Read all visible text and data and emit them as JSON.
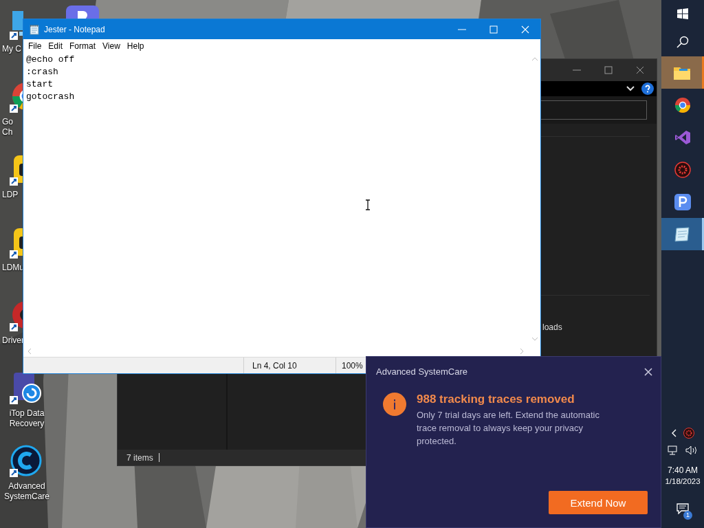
{
  "desktop": {
    "icons": [
      {
        "kind": "computer",
        "label": "My C"
      },
      {
        "kind": "chrome",
        "label": "Go\nCh"
      },
      {
        "kind": "ldplayer",
        "label": "LDP"
      },
      {
        "kind": "ldmulti",
        "label": "LDMu"
      },
      {
        "kind": "driver",
        "label": "Driver"
      },
      {
        "kind": "itop",
        "label": "iTop Data\nRecovery"
      },
      {
        "kind": "asc",
        "label": "Advanced\nSystemCare"
      }
    ]
  },
  "explorer": {
    "nav_item": "loads",
    "status_bar": "7 items"
  },
  "notepad": {
    "title": "Jester - Notepad",
    "menu": [
      "File",
      "Edit",
      "Format",
      "View",
      "Help"
    ],
    "lines": [
      "@echo off",
      ":crash",
      "start",
      "gotocrash"
    ],
    "status": {
      "position": "Ln 4, Col 10",
      "zoom": "100%"
    }
  },
  "notification": {
    "app": "Advanced SystemCare",
    "heading": "988 tracking traces removed",
    "body": "Only 7 trial days are left. Extend the automatic trace removal to always keep your privacy protected.",
    "button": "Extend Now"
  },
  "taskbar": {
    "apps": [
      {
        "kind": "explorer",
        "flashing": true,
        "active": false
      },
      {
        "kind": "chrome",
        "flashing": false,
        "active": false
      },
      {
        "kind": "studio",
        "flashing": false,
        "active": false
      },
      {
        "kind": "gear",
        "flashing": false,
        "active": false
      },
      {
        "kind": "pdf",
        "flashing": false,
        "active": false
      },
      {
        "kind": "notepad",
        "flashing": false,
        "active": true
      }
    ],
    "clock": {
      "time": "7:40 AM",
      "date": "1/18/2023"
    },
    "notifications_badge": "1"
  }
}
